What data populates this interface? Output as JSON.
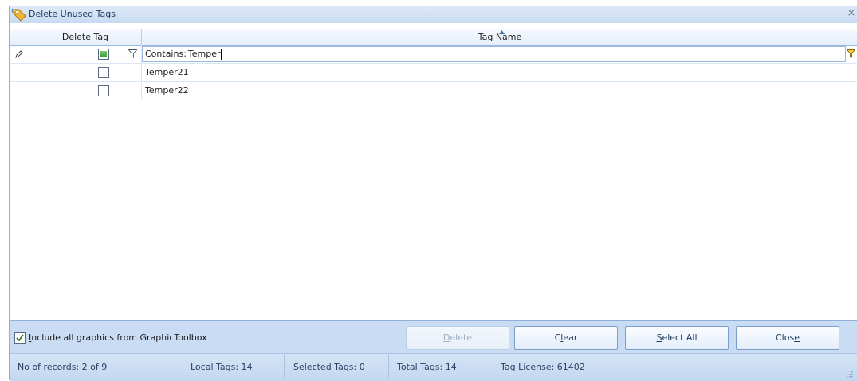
{
  "window": {
    "title": "Delete Unused Tags",
    "close_glyph": "×"
  },
  "grid": {
    "columns": [
      "Delete Tag",
      "Tag Name"
    ],
    "filter": {
      "prefix": "Contains:",
      "value": "Temper"
    },
    "rows": [
      {
        "checked": false,
        "name": "Temper21"
      },
      {
        "checked": false,
        "name": "Temper22"
      }
    ]
  },
  "options": {
    "include_graphics": {
      "checked": true,
      "label_u": "I",
      "label_rest": "nclude all graphics from GraphicToolbox"
    }
  },
  "buttons": {
    "delete": {
      "u": "D",
      "rest": "elete",
      "enabled": false
    },
    "clear": {
      "pre": "C",
      "u": "l",
      "rest": "ear"
    },
    "select_all": {
      "u": "S",
      "rest": "elect All"
    },
    "close": {
      "pre": "Clos",
      "u": "e",
      "rest": ""
    }
  },
  "status": {
    "records": "No of records: 2 of 9",
    "local_tags": "Local Tags: 14",
    "selected_tags": "Selected Tags: 0",
    "total_tags": "Total Tags: 14",
    "tag_license": "Tag License: 61402"
  },
  "icons": {
    "app": "tag-icon",
    "filter": "funnel-icon",
    "edit": "pencil-icon",
    "grip": "resize-grip-icon"
  },
  "colors": {
    "accent": "#1e395b",
    "frame": "#c9dcf3",
    "filter_funnel_active": "#e8a800"
  }
}
